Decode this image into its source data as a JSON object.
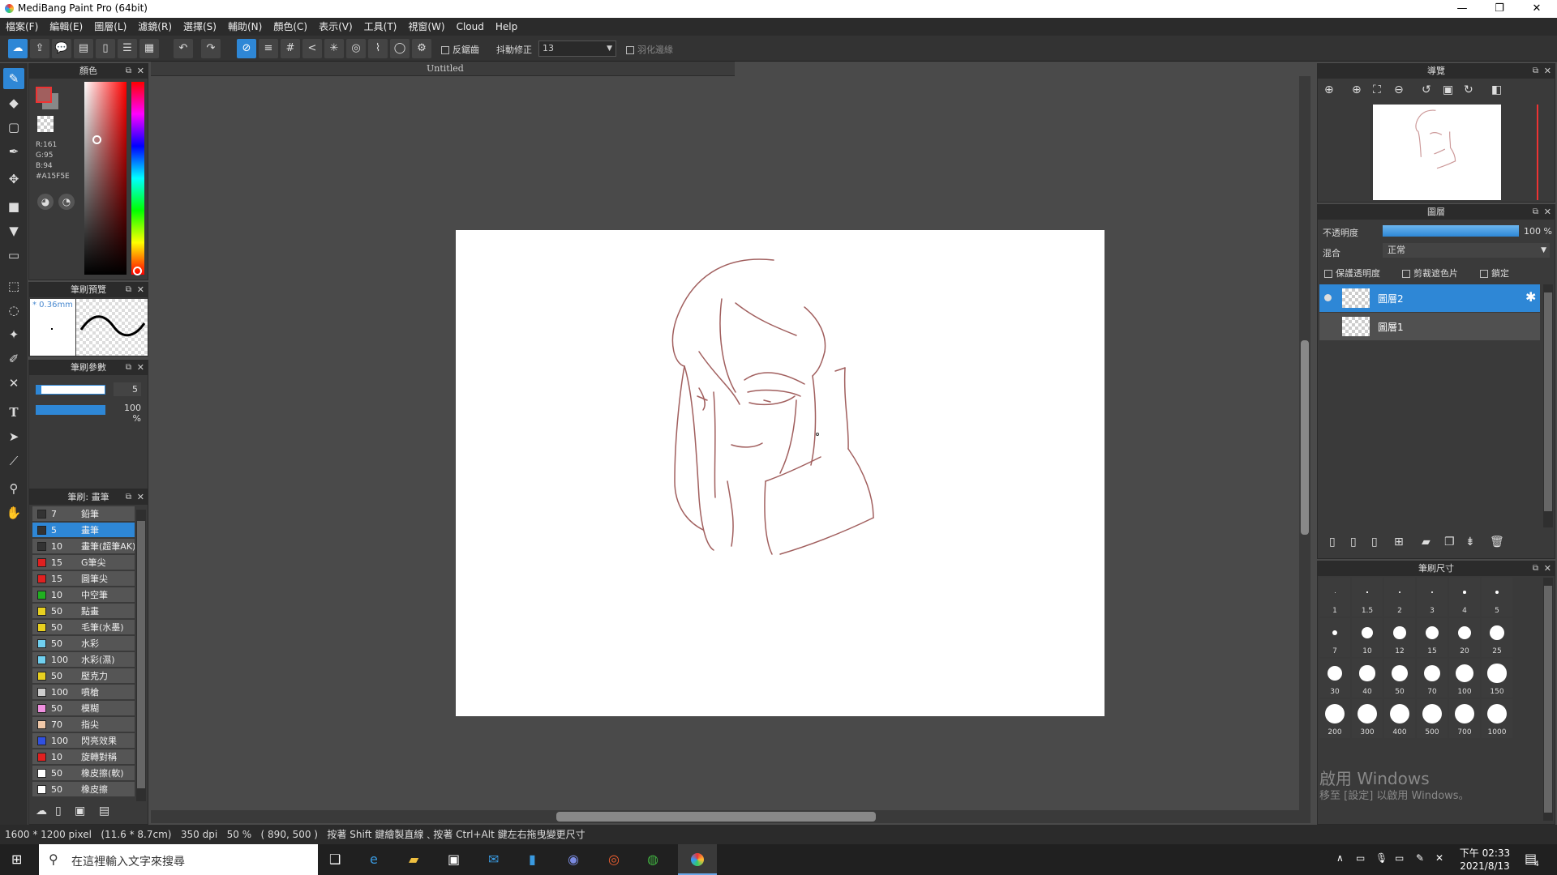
{
  "window": {
    "title": "MediBang Paint Pro (64bit)",
    "minimize": "—",
    "maximize": "❐",
    "close": "✕"
  },
  "menu": [
    "檔案(F)",
    "編輯(E)",
    "圖層(L)",
    "濾鏡(R)",
    "選擇(S)",
    "輔助(N)",
    "顏色(C)",
    "表示(V)",
    "工具(T)",
    "視窗(W)",
    "Cloud",
    "Help"
  ],
  "toolbar": {
    "antialias_label": "反鋸齒",
    "stabilizer_label": "抖動修正",
    "stabilizer_value": "13",
    "feather_label": "羽化邊緣"
  },
  "document": {
    "tab_title": "Untitled"
  },
  "color_panel": {
    "title": "顏色",
    "r": "R:161",
    "g": "G:95",
    "b": "B:94",
    "hex": "#A15F5E",
    "current_color": "#A15F5E"
  },
  "brush_preview": {
    "title": "筆刷預覽",
    "size": "* 0.36mm"
  },
  "brush_params": {
    "title": "筆刷參數",
    "size_value": "5",
    "opacity_value": "100 %"
  },
  "brush_list": {
    "title": "筆刷: 畫筆",
    "items": [
      {
        "size": "7",
        "name": "鉛筆",
        "color": "#333333"
      },
      {
        "size": "5",
        "name": "畫筆",
        "color": "#333333",
        "selected": true
      },
      {
        "size": "10",
        "name": "畫筆(超筆AK)",
        "color": "#333333"
      },
      {
        "size": "15",
        "name": "G筆尖",
        "color": "#e02020"
      },
      {
        "size": "15",
        "name": "圓筆尖",
        "color": "#e02020"
      },
      {
        "size": "10",
        "name": "中空筆",
        "color": "#20b020"
      },
      {
        "size": "50",
        "name": "點畫",
        "color": "#e8d020"
      },
      {
        "size": "50",
        "name": "毛筆(水墨)",
        "color": "#e8d020"
      },
      {
        "size": "50",
        "name": "水彩",
        "color": "#70d0f0"
      },
      {
        "size": "100",
        "name": "水彩(濕)",
        "color": "#70d0f0"
      },
      {
        "size": "50",
        "name": "壓克力",
        "color": "#e8d020"
      },
      {
        "size": "100",
        "name": "噴槍",
        "color": "#cccccc"
      },
      {
        "size": "50",
        "name": "模糊",
        "color": "#f090e0"
      },
      {
        "size": "70",
        "name": "指尖",
        "color": "#f0c8a8"
      },
      {
        "size": "100",
        "name": "閃亮效果",
        "color": "#3050e0"
      },
      {
        "size": "10",
        "name": "旋轉對稱",
        "color": "#e02020"
      },
      {
        "size": "50",
        "name": "橡皮擦(軟)",
        "color": "#ffffff"
      },
      {
        "size": "50",
        "name": "橡皮擦",
        "color": "#ffffff"
      }
    ]
  },
  "navigator": {
    "title": "導覽"
  },
  "layers": {
    "title": "圖層",
    "opacity_label": "不透明度",
    "opacity_value": "100 %",
    "blend_label": "混合",
    "blend_value": "正常",
    "protect_alpha": "保護透明度",
    "clipping": "剪裁遮色片",
    "lock": "鎖定",
    "items": [
      {
        "name": "圖層2",
        "selected": true
      },
      {
        "name": "圖層1",
        "selected": false
      }
    ]
  },
  "brush_size": {
    "title": "筆刷尺寸",
    "sizes": [
      "1",
      "1.5",
      "2",
      "3",
      "4",
      "5",
      "7",
      "10",
      "12",
      "15",
      "20",
      "25",
      "30",
      "40",
      "50",
      "70",
      "100",
      "150",
      "200",
      "300",
      "400",
      "500",
      "700",
      "1000"
    ]
  },
  "watermark": {
    "line1": "啟用 Windows",
    "line2": "移至 [設定] 以啟用 Windows。"
  },
  "status": {
    "text": "1600 * 1200 pixel   (11.6 * 8.7cm)   350 dpi   50 %   ( 890, 500 )   按著 Shift 鍵繪製直線﹑按著 Ctrl+Alt 鍵左右拖曳變更尺寸"
  },
  "taskbar": {
    "search_placeholder": "在這裡輸入文字來搜尋",
    "time": "下午 02:33",
    "date": "2021/8/13",
    "notif_count": "4"
  }
}
